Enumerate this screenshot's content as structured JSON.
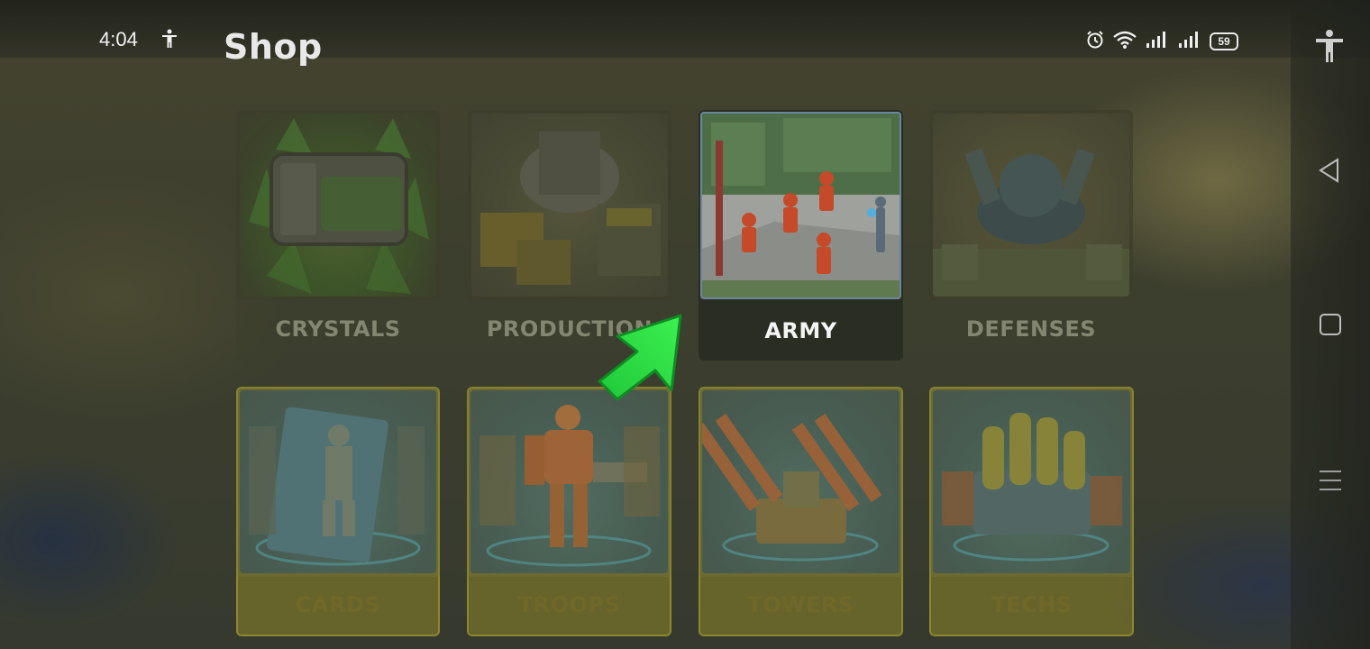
{
  "status_bar": {
    "time": "4:04",
    "battery": "59",
    "icons": [
      "accessibility-icon",
      "alarm-icon",
      "wifi-icon",
      "signal-icon",
      "signal-icon",
      "battery-icon"
    ]
  },
  "header": {
    "title": "Shop"
  },
  "shop": {
    "tiles": [
      {
        "label": "CRYSTALS",
        "state": "dimmed"
      },
      {
        "label": "PRODUCTION",
        "state": "dimmed"
      },
      {
        "label": "ARMY",
        "state": "highlighted"
      },
      {
        "label": "DEFENSES",
        "state": "dimmed"
      },
      {
        "label": "CARDS",
        "state": "dimmed"
      },
      {
        "label": "TROOPS",
        "state": "dimmed"
      },
      {
        "label": "TOWERS",
        "state": "dimmed"
      },
      {
        "label": "TECHS",
        "state": "dimmed"
      }
    ]
  },
  "tutorial": {
    "pointer": "green-arrow-icon",
    "points_to": "ARMY"
  },
  "nav_bar": {
    "buttons": [
      "accessibility-icon",
      "back-icon",
      "home-icon",
      "menu-icon"
    ]
  },
  "colors": {
    "arrow": "#22e03a",
    "highlight_border": "#6a86a0",
    "row2_frame": "#a89a30"
  }
}
